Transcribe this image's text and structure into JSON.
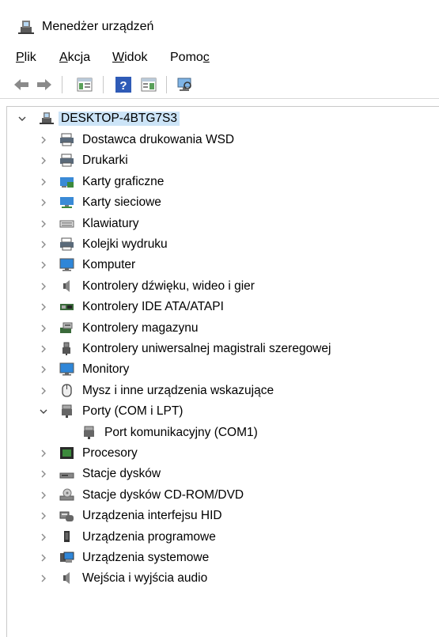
{
  "window": {
    "title": "Menedżer urządzeń"
  },
  "menu": [
    {
      "label": "Plik",
      "u": "P",
      "rest": "lik"
    },
    {
      "label": "Akcja",
      "u": "A",
      "rest": "kcja"
    },
    {
      "label": "Widok",
      "u": "W",
      "rest": "idok"
    },
    {
      "label": "Pomoc",
      "u": "c",
      "pre": "Pomo"
    }
  ],
  "toolbar": {
    "buttons": [
      "back-arrow",
      "forward-arrow",
      "properties",
      "help",
      "update-driver",
      "scan-hardware"
    ]
  },
  "tree": {
    "root": "DESKTOP-4BTG7S3",
    "items": [
      {
        "label": "Dostawca drukowania WSD",
        "icon": "printer-icon",
        "expanded": false
      },
      {
        "label": "Drukarki",
        "icon": "printer-icon",
        "expanded": false
      },
      {
        "label": "Karty graficzne",
        "icon": "display-adapter-icon",
        "expanded": false
      },
      {
        "label": "Karty sieciowe",
        "icon": "network-adapter-icon",
        "expanded": false
      },
      {
        "label": "Klawiatury",
        "icon": "keyboard-icon",
        "expanded": false
      },
      {
        "label": "Kolejki wydruku",
        "icon": "printer-icon",
        "expanded": false
      },
      {
        "label": "Komputer",
        "icon": "monitor-icon",
        "expanded": false
      },
      {
        "label": "Kontrolery dźwięku, wideo i gier",
        "icon": "speaker-icon",
        "expanded": false
      },
      {
        "label": "Kontrolery IDE ATA/ATAPI",
        "icon": "ide-controller-icon",
        "expanded": false
      },
      {
        "label": "Kontrolery magazynu",
        "icon": "storage-controller-icon",
        "expanded": false
      },
      {
        "label": "Kontrolery uniwersalnej magistrali szeregowej",
        "icon": "usb-icon",
        "expanded": false
      },
      {
        "label": "Monitory",
        "icon": "monitor-icon",
        "expanded": false
      },
      {
        "label": "Mysz i inne urządzenia wskazujące",
        "icon": "mouse-icon",
        "expanded": false
      },
      {
        "label": "Porty (COM i LPT)",
        "icon": "port-icon",
        "expanded": true
      },
      {
        "label": "Port komunikacyjny (COM1)",
        "icon": "port-icon",
        "child": true
      },
      {
        "label": "Procesory",
        "icon": "processor-icon",
        "expanded": false
      },
      {
        "label": "Stacje dysków",
        "icon": "disk-drive-icon",
        "expanded": false
      },
      {
        "label": "Stacje dysków CD-ROM/DVD",
        "icon": "cdrom-icon",
        "expanded": false
      },
      {
        "label": "Urządzenia interfejsu HID",
        "icon": "hid-icon",
        "expanded": false
      },
      {
        "label": "Urządzenia programowe",
        "icon": "software-device-icon",
        "expanded": false
      },
      {
        "label": "Urządzenia systemowe",
        "icon": "system-device-icon",
        "expanded": false
      },
      {
        "label": "Wejścia i wyjścia audio",
        "icon": "speaker-icon",
        "expanded": false
      }
    ]
  }
}
